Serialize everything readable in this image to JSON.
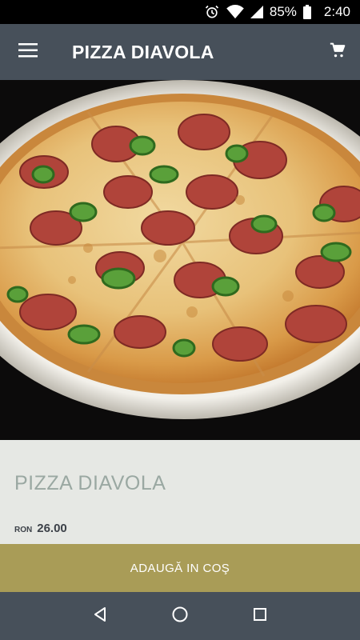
{
  "status_bar": {
    "icons": [
      "alarm-icon",
      "wifi-icon",
      "signal-icon",
      "battery-icon"
    ],
    "battery": "85%",
    "time": "2:40"
  },
  "app_bar": {
    "menu_icon": "hamburger-menu-icon",
    "title": "PIZZA DIAVOLA",
    "cart_icon": "shopping-cart-icon"
  },
  "hero": {
    "image": "pizza-diavola-photo"
  },
  "product": {
    "name": "PIZZA DIAVOLA",
    "currency": "RON",
    "price": "26.00"
  },
  "add_to_cart": {
    "label": "ADAUGĂ IN COŞ"
  },
  "nav_bar": {
    "icons": [
      "back-icon",
      "home-icon",
      "recents-icon"
    ]
  },
  "colors": {
    "app_bar": "#47505a",
    "details_bg": "#e6e8e4",
    "product_name": "#9aa8a2",
    "accent_button": "#a99c57"
  }
}
